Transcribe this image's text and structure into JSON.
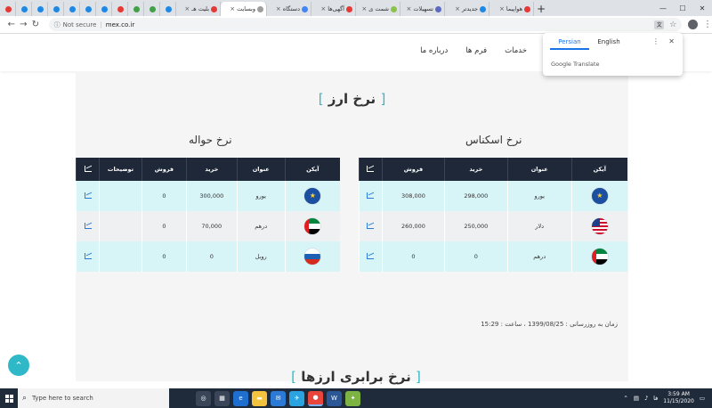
{
  "browser": {
    "tabs": [
      {
        "label": "",
        "color": "#e53935",
        "small": true
      },
      {
        "label": "",
        "color": "#1e88e5",
        "small": true
      },
      {
        "label": "",
        "color": "#1e88e5",
        "small": true
      },
      {
        "label": "",
        "color": "#1e88e5",
        "small": true
      },
      {
        "label": "",
        "color": "#1e88e5",
        "small": true
      },
      {
        "label": "",
        "color": "#1e88e5",
        "small": true
      },
      {
        "label": "",
        "color": "#1e88e5",
        "small": true
      },
      {
        "label": "",
        "color": "#e53935",
        "small": true
      },
      {
        "label": "",
        "color": "#43a047",
        "small": true
      },
      {
        "label": "",
        "color": "#43a047",
        "small": true
      },
      {
        "label": "",
        "color": "#1e88e5",
        "small": true
      },
      {
        "label": "بلیت هـ",
        "color": "#e53935",
        "small": false
      },
      {
        "label": "وبسایت",
        "color": "#9e9e9e",
        "small": false,
        "active": true
      },
      {
        "label": "دستگاه",
        "color": "#4285f4",
        "small": false
      },
      {
        "label": "آگهی‌ها",
        "color": "#e53935",
        "small": false
      },
      {
        "label": "شمت ی",
        "color": "#8bc34a",
        "small": false
      },
      {
        "label": "تسهیلات",
        "color": "#5c6bc0",
        "small": false
      },
      {
        "label": "جدیدتر",
        "color": "#1e88e5",
        "small": false
      },
      {
        "label": "هواپیما",
        "color": "#e53935",
        "small": false
      }
    ],
    "new_tab": "+",
    "address": {
      "security": "Not secure",
      "url": "mex.co.ir"
    }
  },
  "translate_popup": {
    "lang_target": "Persian",
    "lang_source": "English",
    "brand": "Google Translate",
    "dots": "⋮",
    "close": "✕"
  },
  "site": {
    "nav": [
      "خدمات",
      "فرم ها",
      "درباره ما"
    ],
    "title": "نرخ ارز",
    "cash_title": "نرخ اسکناس",
    "transfer_title": "نرخ حواله",
    "cash_table": {
      "headers": [
        "آیکن",
        "عنوان",
        "خرید",
        "فروش"
      ],
      "rows": [
        {
          "flag": "eu",
          "name": "یورو",
          "buy": "298,000",
          "sell": "308,000",
          "shade": "cyan"
        },
        {
          "flag": "us",
          "name": "دلار",
          "buy": "250,000",
          "sell": "260,000",
          "shade": "grey"
        },
        {
          "flag": "ae",
          "name": "درهم",
          "buy": "0",
          "sell": "0",
          "shade": "cyan"
        }
      ]
    },
    "transfer_table": {
      "headers": [
        "آیکن",
        "عنوان",
        "خرید",
        "فروش",
        "توضیحات"
      ],
      "rows": [
        {
          "flag": "eu",
          "name": "یورو",
          "buy": "300,000",
          "sell": "0",
          "desc": "",
          "shade": "cyan"
        },
        {
          "flag": "ae",
          "name": "درهم",
          "buy": "70,000",
          "sell": "0",
          "desc": "",
          "shade": "grey"
        },
        {
          "flag": "ru",
          "name": "روبل",
          "buy": "0",
          "sell": "0",
          "desc": "",
          "shade": "cyan"
        }
      ]
    },
    "update_time": "زمان به روزرسانی : 1399/08/25 ، ساعت : 15:29",
    "second_title": "نرخ برابری ارزها",
    "scroll_top": "⌃"
  },
  "taskbar": {
    "search_placeholder": "Type here to search",
    "apps": [
      {
        "glyph": "◎",
        "color": "#3a4658"
      },
      {
        "glyph": "▦",
        "color": "#3a4658"
      },
      {
        "glyph": "e",
        "color": "#1e6fd0"
      },
      {
        "glyph": "▬",
        "color": "#f3c33d"
      },
      {
        "glyph": "✉",
        "color": "#2b7bd6"
      },
      {
        "glyph": "✈",
        "color": "#2aa3e0"
      },
      {
        "glyph": "●",
        "color": "#e8453c",
        "active": true
      },
      {
        "glyph": "W",
        "color": "#2b5797"
      },
      {
        "glyph": "✦",
        "color": "#7cb342"
      }
    ],
    "lang": "فا",
    "time": "3:59 AM",
    "date": "11/15/2020"
  }
}
